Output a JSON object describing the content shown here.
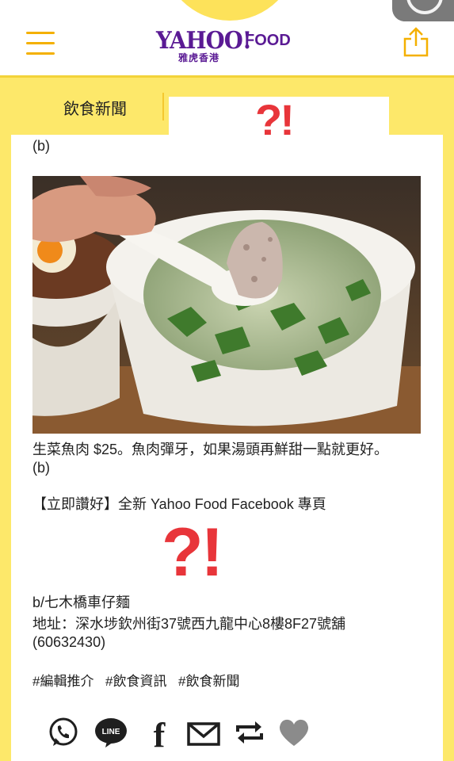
{
  "header": {
    "brand": "YAHOO!",
    "brand_sub": "FOOD",
    "brand_region": "雅虎香港",
    "menu_icon": "hamburger-menu-icon",
    "share_icon": "share-upload-icon",
    "accent_color": "#f4b000",
    "brand_color": "#5a1a94"
  },
  "nav": {
    "active_tab": "飲食新聞",
    "badge": "?!"
  },
  "article": {
    "caption_top": "(b)",
    "photo_alt": "生菜魚肉",
    "caption_line1": "生菜魚肉 $25。魚肉彈牙，如果湯頭再鮮甜一點就更好。",
    "caption_line2": "(b)",
    "promo": "【立即讚好】全新 Yahoo Food Facebook 專頁",
    "badge": "?!",
    "shop_name": "b/七木橋車仔麵",
    "address": "地址：深水埗欽州街37號西九龍中心8樓8F27號舖",
    "phone": "(60632430)",
    "tags": [
      "#編輯推介",
      "#飲食資訊",
      "#飲食新聞"
    ]
  },
  "share_icons": [
    "whatsapp-icon",
    "line-icon",
    "facebook-icon",
    "email-icon",
    "repost-icon",
    "heart-icon"
  ],
  "line_label": "LINE",
  "facebook_label": "f",
  "colors": {
    "band": "#fde86a",
    "badge_red": "#e8353a",
    "icon_dark": "#1f1f1f",
    "heart_grey": "#8b8b8b"
  }
}
